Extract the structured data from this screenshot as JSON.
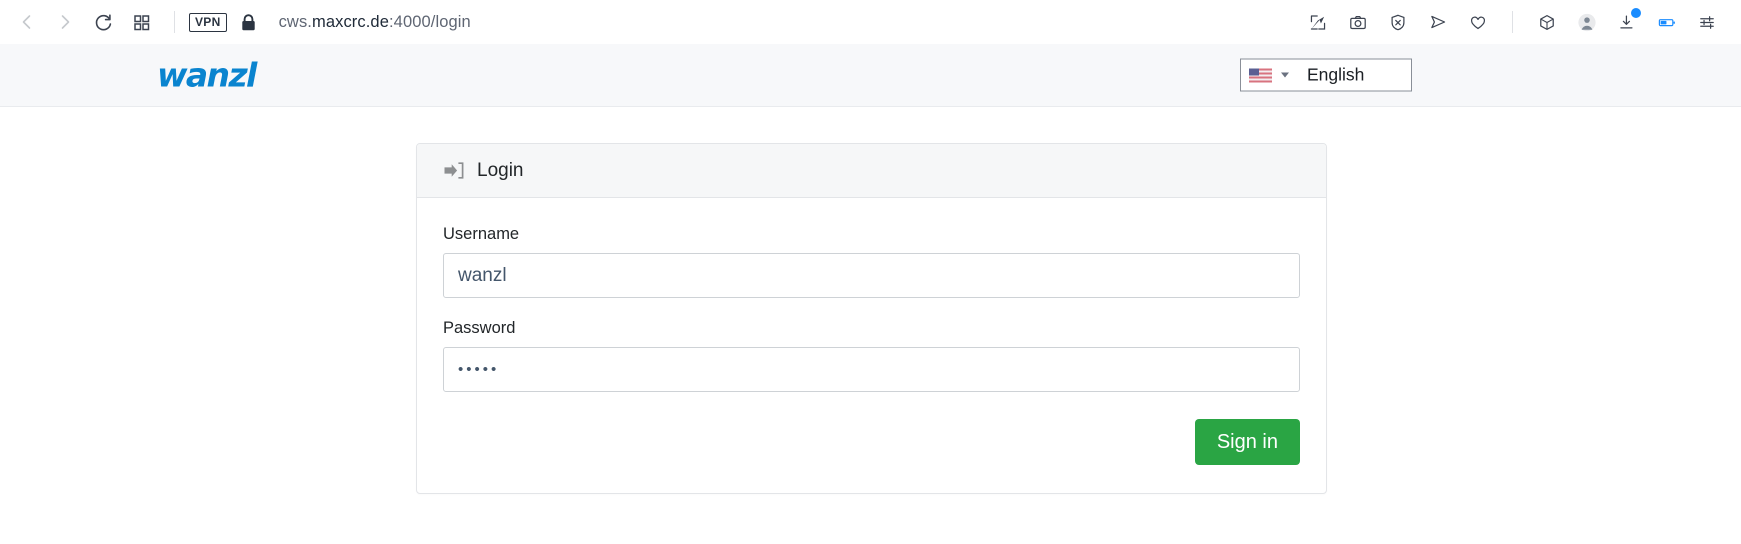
{
  "browser": {
    "nav": {
      "back_icon": "chevron-left-icon",
      "forward_icon": "chevron-right-icon",
      "reload_icon": "reload-icon",
      "tabs_grid_icon": "grid-tabs-icon"
    },
    "vpn_badge": "VPN",
    "lock_icon": "padlock-icon",
    "url": {
      "prefix": "cws.",
      "host": "maxcrc.de",
      "suffix": ":4000/login",
      "full": "cws.maxcrc.de:4000/login"
    },
    "toolbar_icons": [
      "screenshot-region-icon",
      "camera-icon",
      "shield-block-icon",
      "send-icon",
      "heart-icon",
      "cube-icon",
      "account-avatar-icon",
      "download-icon",
      "battery-icon",
      "settings-sliders-icon"
    ],
    "download_badge": true
  },
  "site_header": {
    "logo_text": "wanzl",
    "logo_color": "#0a84cf",
    "language": {
      "label": "English",
      "flag_icon": "us-flag-icon",
      "caret_icon": "caret-down-icon",
      "options": [
        "English"
      ]
    }
  },
  "login": {
    "title": "Login",
    "title_icon": "sign-in-arrow-icon",
    "username": {
      "label": "Username",
      "value": "wanzl",
      "placeholder": "Username"
    },
    "password": {
      "label": "Password",
      "value": "•••••",
      "placeholder": "Password",
      "masked_length": 5
    },
    "submit": {
      "label": "Sign in",
      "color": "#2aa544"
    }
  }
}
